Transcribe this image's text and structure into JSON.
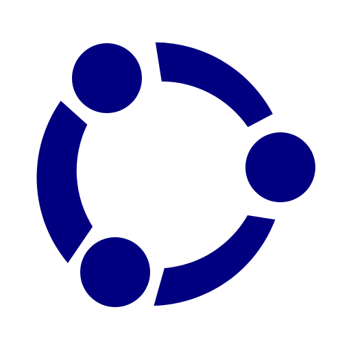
{
  "logo": {
    "name": "three-node-ring-logo",
    "color": "#000080",
    "background": "#ffffff"
  }
}
